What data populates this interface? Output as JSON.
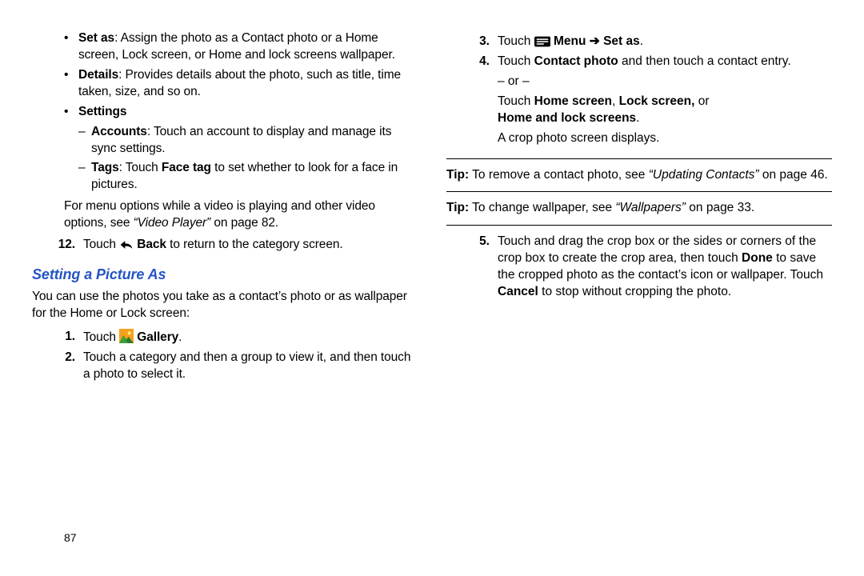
{
  "pageNumber": "87",
  "left": {
    "bullets": [
      {
        "label": "Set as",
        "rest": ": Assign the photo as a Contact photo or a Home screen, Lock screen, or Home and lock screens wallpaper."
      },
      {
        "label": "Details",
        "rest": ": Provides details about the photo, such as title, time taken, size, and so on."
      },
      {
        "label": "Settings",
        "rest": ""
      }
    ],
    "dashes": [
      {
        "label": "Accounts",
        "rest": ": Touch an account to display and manage its sync settings."
      },
      {
        "label": "Tags",
        "rest_pre": ": Touch ",
        "bold_mid": "Face tag",
        "rest_post": " to set whether to look for a face in pictures."
      }
    ],
    "videoNote": {
      "pre": "For menu options while a video is playing and other video options, see ",
      "link": "“Video Player”",
      "post": " on page 82."
    },
    "step12": {
      "num": "12.",
      "pre": "Touch ",
      "iconLabel": "Back",
      "post": " to return to the category screen."
    },
    "heading": "Setting a Picture As",
    "intro": "You can use the photos you take as a contact’s photo or as wallpaper for the Home or Lock screen:",
    "step1": {
      "num": "1.",
      "pre": "Touch ",
      "iconLabel": "Gallery",
      "post": "."
    },
    "step2": {
      "num": "2.",
      "text": "Touch a category and then a group to view it, and then touch a photo to select it."
    }
  },
  "right": {
    "step3": {
      "num": "3.",
      "pre": "Touch ",
      "menuLabel": "Menu",
      "arrow": " ➔ ",
      "setAs": "Set as",
      "post": "."
    },
    "step4": {
      "num": "4.",
      "line1_pre": "Touch ",
      "line1_bold": "Contact photo",
      "line1_post": " and then touch a contact entry.",
      "or": "– or –",
      "line2_pre": "Touch ",
      "line2_bold1": "Home screen",
      "line2_mid1": ", ",
      "line2_bold2": "Lock screen,",
      "line2_mid2": " or ",
      "line2_bold3": "Home and lock screens",
      "line2_post": ".",
      "line3": "A crop photo screen displays."
    },
    "tip1": {
      "pre": "Tip:",
      "mid": " To remove a contact photo, see ",
      "link": "“Updating Contacts”",
      "post": " on page 46."
    },
    "tip2": {
      "pre": "Tip:",
      "mid": " To change wallpaper, see ",
      "link": "“Wallpapers”",
      "post": " on page 33."
    },
    "step5": {
      "num": "5.",
      "pre": "Touch and drag the crop box or the sides or corners of the crop box to create the crop area, then touch ",
      "bold1": "Done",
      "mid": " to save the cropped photo as the contact’s icon or wallpaper. Touch ",
      "bold2": "Cancel",
      "post": " to stop without cropping the photo."
    }
  }
}
